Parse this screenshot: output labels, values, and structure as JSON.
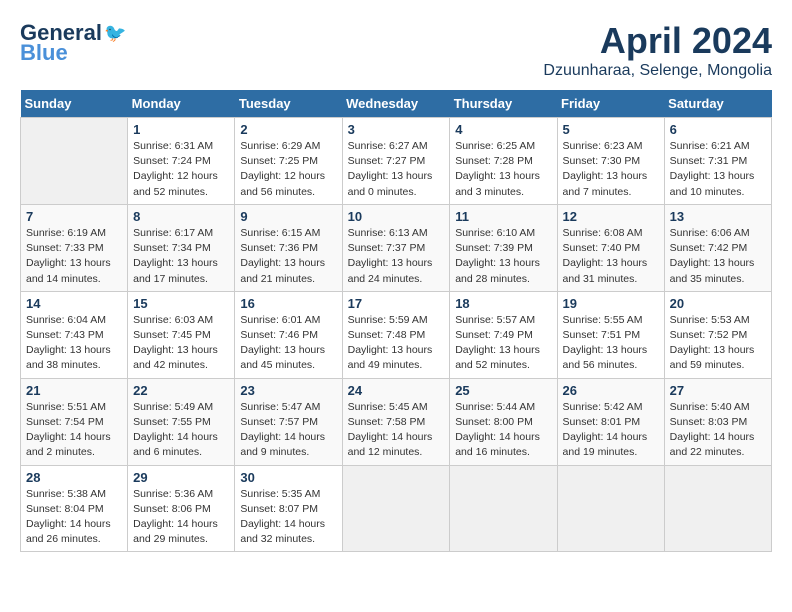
{
  "header": {
    "logo_general": "General",
    "logo_blue": "Blue",
    "month_year": "April 2024",
    "location": "Dzuunharaa, Selenge, Mongolia"
  },
  "days_of_week": [
    "Sunday",
    "Monday",
    "Tuesday",
    "Wednesday",
    "Thursday",
    "Friday",
    "Saturday"
  ],
  "weeks": [
    [
      {
        "day": "",
        "sunrise": "",
        "sunset": "",
        "daylight": ""
      },
      {
        "day": "1",
        "sunrise": "Sunrise: 6:31 AM",
        "sunset": "Sunset: 7:24 PM",
        "daylight": "Daylight: 12 hours and 52 minutes."
      },
      {
        "day": "2",
        "sunrise": "Sunrise: 6:29 AM",
        "sunset": "Sunset: 7:25 PM",
        "daylight": "Daylight: 12 hours and 56 minutes."
      },
      {
        "day": "3",
        "sunrise": "Sunrise: 6:27 AM",
        "sunset": "Sunset: 7:27 PM",
        "daylight": "Daylight: 13 hours and 0 minutes."
      },
      {
        "day": "4",
        "sunrise": "Sunrise: 6:25 AM",
        "sunset": "Sunset: 7:28 PM",
        "daylight": "Daylight: 13 hours and 3 minutes."
      },
      {
        "day": "5",
        "sunrise": "Sunrise: 6:23 AM",
        "sunset": "Sunset: 7:30 PM",
        "daylight": "Daylight: 13 hours and 7 minutes."
      },
      {
        "day": "6",
        "sunrise": "Sunrise: 6:21 AM",
        "sunset": "Sunset: 7:31 PM",
        "daylight": "Daylight: 13 hours and 10 minutes."
      }
    ],
    [
      {
        "day": "7",
        "sunrise": "Sunrise: 6:19 AM",
        "sunset": "Sunset: 7:33 PM",
        "daylight": "Daylight: 13 hours and 14 minutes."
      },
      {
        "day": "8",
        "sunrise": "Sunrise: 6:17 AM",
        "sunset": "Sunset: 7:34 PM",
        "daylight": "Daylight: 13 hours and 17 minutes."
      },
      {
        "day": "9",
        "sunrise": "Sunrise: 6:15 AM",
        "sunset": "Sunset: 7:36 PM",
        "daylight": "Daylight: 13 hours and 21 minutes."
      },
      {
        "day": "10",
        "sunrise": "Sunrise: 6:13 AM",
        "sunset": "Sunset: 7:37 PM",
        "daylight": "Daylight: 13 hours and 24 minutes."
      },
      {
        "day": "11",
        "sunrise": "Sunrise: 6:10 AM",
        "sunset": "Sunset: 7:39 PM",
        "daylight": "Daylight: 13 hours and 28 minutes."
      },
      {
        "day": "12",
        "sunrise": "Sunrise: 6:08 AM",
        "sunset": "Sunset: 7:40 PM",
        "daylight": "Daylight: 13 hours and 31 minutes."
      },
      {
        "day": "13",
        "sunrise": "Sunrise: 6:06 AM",
        "sunset": "Sunset: 7:42 PM",
        "daylight": "Daylight: 13 hours and 35 minutes."
      }
    ],
    [
      {
        "day": "14",
        "sunrise": "Sunrise: 6:04 AM",
        "sunset": "Sunset: 7:43 PM",
        "daylight": "Daylight: 13 hours and 38 minutes."
      },
      {
        "day": "15",
        "sunrise": "Sunrise: 6:03 AM",
        "sunset": "Sunset: 7:45 PM",
        "daylight": "Daylight: 13 hours and 42 minutes."
      },
      {
        "day": "16",
        "sunrise": "Sunrise: 6:01 AM",
        "sunset": "Sunset: 7:46 PM",
        "daylight": "Daylight: 13 hours and 45 minutes."
      },
      {
        "day": "17",
        "sunrise": "Sunrise: 5:59 AM",
        "sunset": "Sunset: 7:48 PM",
        "daylight": "Daylight: 13 hours and 49 minutes."
      },
      {
        "day": "18",
        "sunrise": "Sunrise: 5:57 AM",
        "sunset": "Sunset: 7:49 PM",
        "daylight": "Daylight: 13 hours and 52 minutes."
      },
      {
        "day": "19",
        "sunrise": "Sunrise: 5:55 AM",
        "sunset": "Sunset: 7:51 PM",
        "daylight": "Daylight: 13 hours and 56 minutes."
      },
      {
        "day": "20",
        "sunrise": "Sunrise: 5:53 AM",
        "sunset": "Sunset: 7:52 PM",
        "daylight": "Daylight: 13 hours and 59 minutes."
      }
    ],
    [
      {
        "day": "21",
        "sunrise": "Sunrise: 5:51 AM",
        "sunset": "Sunset: 7:54 PM",
        "daylight": "Daylight: 14 hours and 2 minutes."
      },
      {
        "day": "22",
        "sunrise": "Sunrise: 5:49 AM",
        "sunset": "Sunset: 7:55 PM",
        "daylight": "Daylight: 14 hours and 6 minutes."
      },
      {
        "day": "23",
        "sunrise": "Sunrise: 5:47 AM",
        "sunset": "Sunset: 7:57 PM",
        "daylight": "Daylight: 14 hours and 9 minutes."
      },
      {
        "day": "24",
        "sunrise": "Sunrise: 5:45 AM",
        "sunset": "Sunset: 7:58 PM",
        "daylight": "Daylight: 14 hours and 12 minutes."
      },
      {
        "day": "25",
        "sunrise": "Sunrise: 5:44 AM",
        "sunset": "Sunset: 8:00 PM",
        "daylight": "Daylight: 14 hours and 16 minutes."
      },
      {
        "day": "26",
        "sunrise": "Sunrise: 5:42 AM",
        "sunset": "Sunset: 8:01 PM",
        "daylight": "Daylight: 14 hours and 19 minutes."
      },
      {
        "day": "27",
        "sunrise": "Sunrise: 5:40 AM",
        "sunset": "Sunset: 8:03 PM",
        "daylight": "Daylight: 14 hours and 22 minutes."
      }
    ],
    [
      {
        "day": "28",
        "sunrise": "Sunrise: 5:38 AM",
        "sunset": "Sunset: 8:04 PM",
        "daylight": "Daylight: 14 hours and 26 minutes."
      },
      {
        "day": "29",
        "sunrise": "Sunrise: 5:36 AM",
        "sunset": "Sunset: 8:06 PM",
        "daylight": "Daylight: 14 hours and 29 minutes."
      },
      {
        "day": "30",
        "sunrise": "Sunrise: 5:35 AM",
        "sunset": "Sunset: 8:07 PM",
        "daylight": "Daylight: 14 hours and 32 minutes."
      },
      {
        "day": "",
        "sunrise": "",
        "sunset": "",
        "daylight": ""
      },
      {
        "day": "",
        "sunrise": "",
        "sunset": "",
        "daylight": ""
      },
      {
        "day": "",
        "sunrise": "",
        "sunset": "",
        "daylight": ""
      },
      {
        "day": "",
        "sunrise": "",
        "sunset": "",
        "daylight": ""
      }
    ]
  ]
}
